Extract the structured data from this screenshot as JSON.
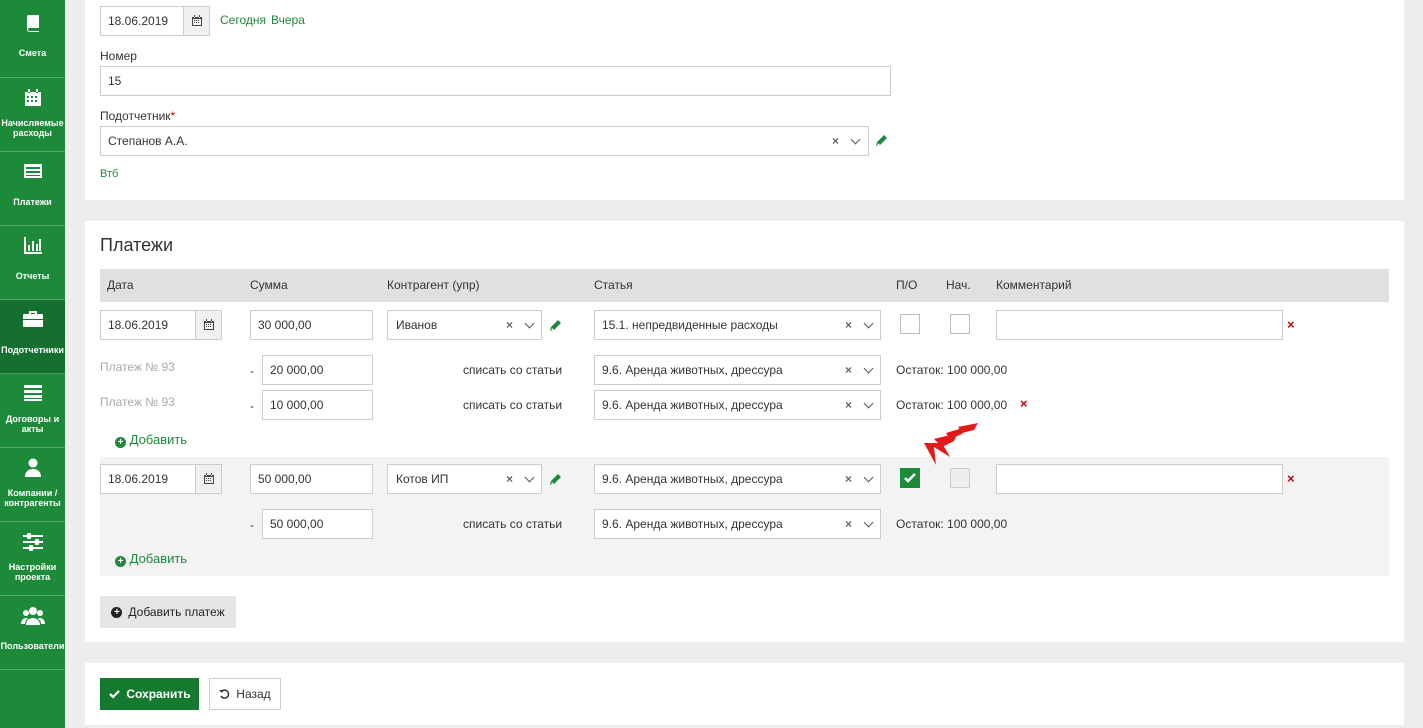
{
  "sidebar": {
    "items": [
      {
        "label": "Смета",
        "icon": "book-icon"
      },
      {
        "label": "Начисляемые расходы",
        "icon": "calendar-icon"
      },
      {
        "label": "Платежи",
        "icon": "list-icon"
      },
      {
        "label": "Отчеты",
        "icon": "bar-chart-icon"
      },
      {
        "label": "Подотчетники",
        "icon": "briefcase-icon"
      },
      {
        "label": "Договоры и акты",
        "icon": "list-lines-icon"
      },
      {
        "label": "Компании / контрагенты",
        "icon": "user-icon"
      },
      {
        "label": "Настройки проекта",
        "icon": "sliders-icon"
      },
      {
        "label": "Пользователи",
        "icon": "users-icon"
      }
    ],
    "active_index": 4
  },
  "header_form": {
    "date_value": "18.06.2019",
    "today_link": "Сегодня",
    "yesterday_link": "Вчера",
    "number_label": "Номер",
    "number_value": "15",
    "accountable_label": "Подотчетник",
    "accountable_value": "Степанов А.А.",
    "bank_link": "Втб"
  },
  "payments": {
    "title": "Платежи",
    "columns": [
      "Дата",
      "Сумма",
      "Контрагент (упр)",
      "Статья",
      "П/О",
      "Нач.",
      "Комментарий"
    ],
    "rows": [
      {
        "date": "18.06.2019",
        "amount": "30 000,00",
        "counterparty": "Иванов",
        "article": "15.1. непредвиденные расходы",
        "po_checked": false,
        "nach_checked": false,
        "comment": "",
        "writeoffs": [
          {
            "payment_ref": "Платеж № 93",
            "dash": "-",
            "amount": "20 000,00",
            "action": "списать со статьи",
            "article": "9.6. Аренда животных, дрессура",
            "remainder": "Остаток: 100 000,00"
          },
          {
            "payment_ref": "Платеж № 93",
            "dash": "-",
            "amount": "10 000,00",
            "action": "списать со статьи",
            "article": "9.6. Аренда животных, дрессура",
            "remainder": "Остаток: 100 000,00"
          }
        ],
        "add_label": "Добавить"
      },
      {
        "date": "18.06.2019",
        "amount": "50 000,00",
        "counterparty": "Котов ИП",
        "article": "9.6. Аренда животных, дрессура",
        "po_checked": true,
        "nach_checked": false,
        "comment": "",
        "writeoffs": [
          {
            "payment_ref": "",
            "dash": "-",
            "amount": "50 000,00",
            "action": "списать со статьи",
            "article": "9.6. Аренда животных, дрессура",
            "remainder": "Остаток: 100 000,00"
          }
        ],
        "add_label": "Добавить"
      }
    ],
    "add_payment_label": "Добавить платеж"
  },
  "footer": {
    "save_label": "Сохранить",
    "back_label": "Назад"
  },
  "colors": {
    "brand_green": "#1d8a3a",
    "delete_red": "#cc0000",
    "annotation_red": "#e21a1a"
  }
}
